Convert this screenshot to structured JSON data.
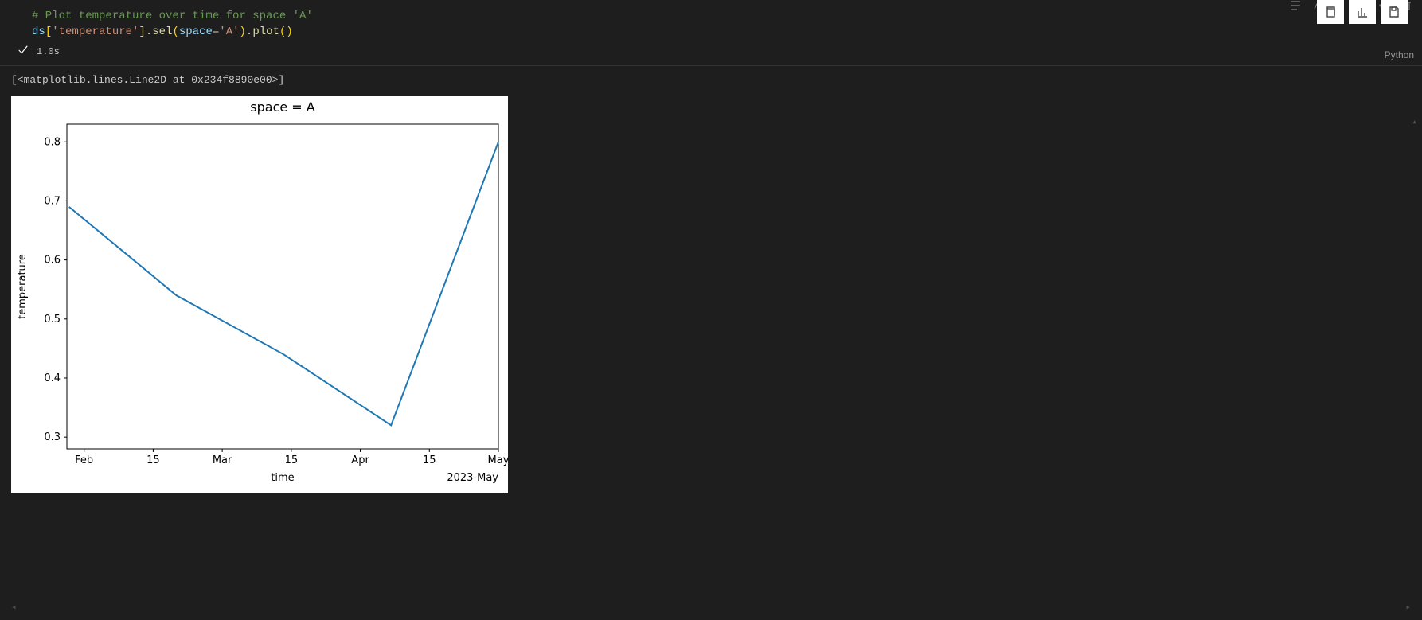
{
  "cell": {
    "code_tokens": [
      {
        "t": "# Plot temperature over time for space 'A'",
        "c": "tok-comment"
      },
      {
        "t": "\n",
        "c": ""
      },
      {
        "t": "ds",
        "c": "tok-var"
      },
      {
        "t": "[",
        "c": "tok-brack"
      },
      {
        "t": "'temperature'",
        "c": "tok-str"
      },
      {
        "t": "]",
        "c": "tok-brack"
      },
      {
        "t": ".",
        "c": "tok-dot"
      },
      {
        "t": "sel",
        "c": "tok-func"
      },
      {
        "t": "(",
        "c": "tok-brack"
      },
      {
        "t": "space",
        "c": "tok-kw"
      },
      {
        "t": "=",
        "c": "tok-dot"
      },
      {
        "t": "'A'",
        "c": "tok-str"
      },
      {
        "t": ")",
        "c": "tok-brack"
      },
      {
        "t": ".",
        "c": "tok-dot"
      },
      {
        "t": "plot",
        "c": "tok-func"
      },
      {
        "t": "()",
        "c": "tok-brack"
      }
    ],
    "exec_time": "1.0s",
    "language": "Python"
  },
  "output": {
    "repr": "[<matplotlib.lines.Line2D at 0x234f8890e00>]"
  },
  "chart_data": {
    "type": "line",
    "title": "space = A",
    "xlabel": "time",
    "ylabel": "temperature",
    "secondary_xlabel": "2023-May",
    "x_ticks": [
      "Feb",
      "15",
      "Mar",
      "15",
      "Apr",
      "15",
      "May"
    ],
    "y_ticks": [
      0.3,
      0.4,
      0.5,
      0.6,
      0.7,
      0.8
    ],
    "ylim": [
      0.28,
      0.83
    ],
    "series": [
      {
        "name": "temperature",
        "x_index": [
          0,
          1,
          2,
          3,
          4
        ],
        "x_labels": [
          "2023-01",
          "2023-02",
          "2023-03",
          "2023-04",
          "2023-05"
        ],
        "values": [
          0.69,
          0.54,
          0.44,
          0.32,
          0.8
        ]
      }
    ],
    "line_color": "#1f77b4"
  },
  "icons": {
    "copy": "copy",
    "chart": "chart",
    "save": "save"
  }
}
